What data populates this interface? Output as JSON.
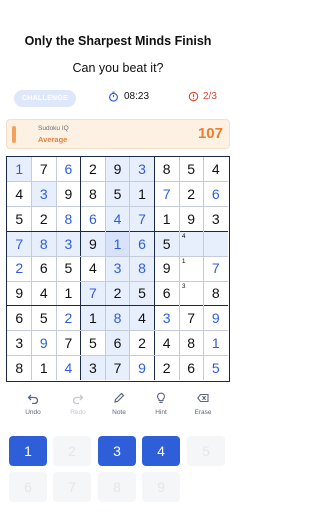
{
  "header": {
    "title": "Only the Sharpest Minds Finish",
    "subtitle": "Can you beat it?"
  },
  "status": {
    "challenge_label": "CHALLENGE",
    "timer": "08:23",
    "mistakes": "2/3",
    "timer_icon": "stopwatch-icon",
    "mistakes_icon": "alert-circle-icon"
  },
  "banner": {
    "app_name": "Sudoku IQ",
    "level": "Average",
    "score": "107"
  },
  "board": {
    "rows": [
      [
        "1",
        "7",
        "6",
        "2",
        "9",
        "3",
        "8",
        "5",
        "4"
      ],
      [
        "4",
        "3",
        "9",
        "8",
        "5",
        "1",
        "7",
        "2",
        "6"
      ],
      [
        "5",
        "2",
        "8",
        "6",
        "4",
        "7",
        "1",
        "9",
        "3"
      ],
      [
        "7",
        "8",
        "3",
        "9",
        "1",
        "6",
        "5",
        "",
        ""
      ],
      [
        "2",
        "6",
        "5",
        "4",
        "3",
        "8",
        "9",
        "",
        "7"
      ],
      [
        "9",
        "4",
        "1",
        "7",
        "2",
        "5",
        "6",
        "",
        "8"
      ],
      [
        "6",
        "5",
        "2",
        "1",
        "8",
        "4",
        "3",
        "7",
        "9"
      ],
      [
        "3",
        "9",
        "7",
        "5",
        "6",
        "2",
        "4",
        "8",
        "1"
      ],
      [
        "8",
        "1",
        "4",
        "3",
        "7",
        "9",
        "2",
        "6",
        "5"
      ]
    ],
    "user_cells": [
      [
        0,
        0
      ],
      [
        0,
        2
      ],
      [
        0,
        5
      ],
      [
        1,
        1
      ],
      [
        1,
        6
      ],
      [
        1,
        8
      ],
      [
        2,
        2
      ],
      [
        2,
        3
      ],
      [
        2,
        4
      ],
      [
        2,
        5
      ],
      [
        3,
        0
      ],
      [
        3,
        1
      ],
      [
        3,
        2
      ],
      [
        3,
        4
      ],
      [
        3,
        5
      ],
      [
        4,
        0
      ],
      [
        4,
        4
      ],
      [
        4,
        5
      ],
      [
        4,
        8
      ],
      [
        5,
        3
      ],
      [
        6,
        2
      ],
      [
        6,
        4
      ],
      [
        6,
        6
      ],
      [
        6,
        8
      ],
      [
        7,
        1
      ],
      [
        7,
        8
      ],
      [
        8,
        2
      ],
      [
        8,
        5
      ],
      [
        8,
        8
      ]
    ],
    "highlight_cells": [
      [
        0,
        0
      ],
      [
        1,
        1
      ],
      [
        0,
        5
      ],
      [
        1,
        5
      ],
      [
        2,
        5
      ],
      [
        3,
        0
      ],
      [
        3,
        1
      ],
      [
        3,
        2
      ],
      [
        3,
        3
      ],
      [
        3,
        4
      ],
      [
        3,
        5
      ],
      [
        3,
        6
      ],
      [
        3,
        7
      ],
      [
        3,
        8
      ],
      [
        4,
        4
      ],
      [
        4,
        5
      ],
      [
        5,
        3
      ],
      [
        5,
        4
      ],
      [
        5,
        5
      ],
      [
        6,
        4
      ],
      [
        7,
        4
      ],
      [
        8,
        4
      ],
      [
        0,
        4
      ],
      [
        1,
        4
      ],
      [
        2,
        4
      ],
      [
        6,
        3
      ],
      [
        6,
        5
      ],
      [
        8,
        3
      ]
    ],
    "selected_cells": [
      [
        3,
        4
      ]
    ],
    "notes": [
      {
        "row": 3,
        "col": 7,
        "value": "4"
      },
      {
        "row": 4,
        "col": 7,
        "value": "1"
      },
      {
        "row": 5,
        "col": 7,
        "value": "3"
      }
    ]
  },
  "toolbar": {
    "tools": [
      {
        "label": "Undo",
        "icon": "undo-icon",
        "enabled": true
      },
      {
        "label": "Redo",
        "icon": "redo-icon",
        "enabled": false
      },
      {
        "label": "Note",
        "icon": "pencil-icon",
        "enabled": true
      },
      {
        "label": "Hint",
        "icon": "lightbulb-icon",
        "enabled": true
      },
      {
        "label": "Erase",
        "icon": "eraser-icon",
        "enabled": true
      }
    ]
  },
  "keypad": {
    "keys": [
      {
        "value": "1",
        "enabled": true
      },
      {
        "value": "2",
        "enabled": false
      },
      {
        "value": "3",
        "enabled": true
      },
      {
        "value": "4",
        "enabled": true
      },
      {
        "value": "5",
        "enabled": false
      },
      {
        "value": "6",
        "enabled": false
      },
      {
        "value": "7",
        "enabled": false
      },
      {
        "value": "8",
        "enabled": false
      },
      {
        "value": "9",
        "enabled": false
      }
    ]
  },
  "colors": {
    "accent": "#2f5fd8",
    "error": "#e0442b",
    "score": "#ee7d2e"
  }
}
